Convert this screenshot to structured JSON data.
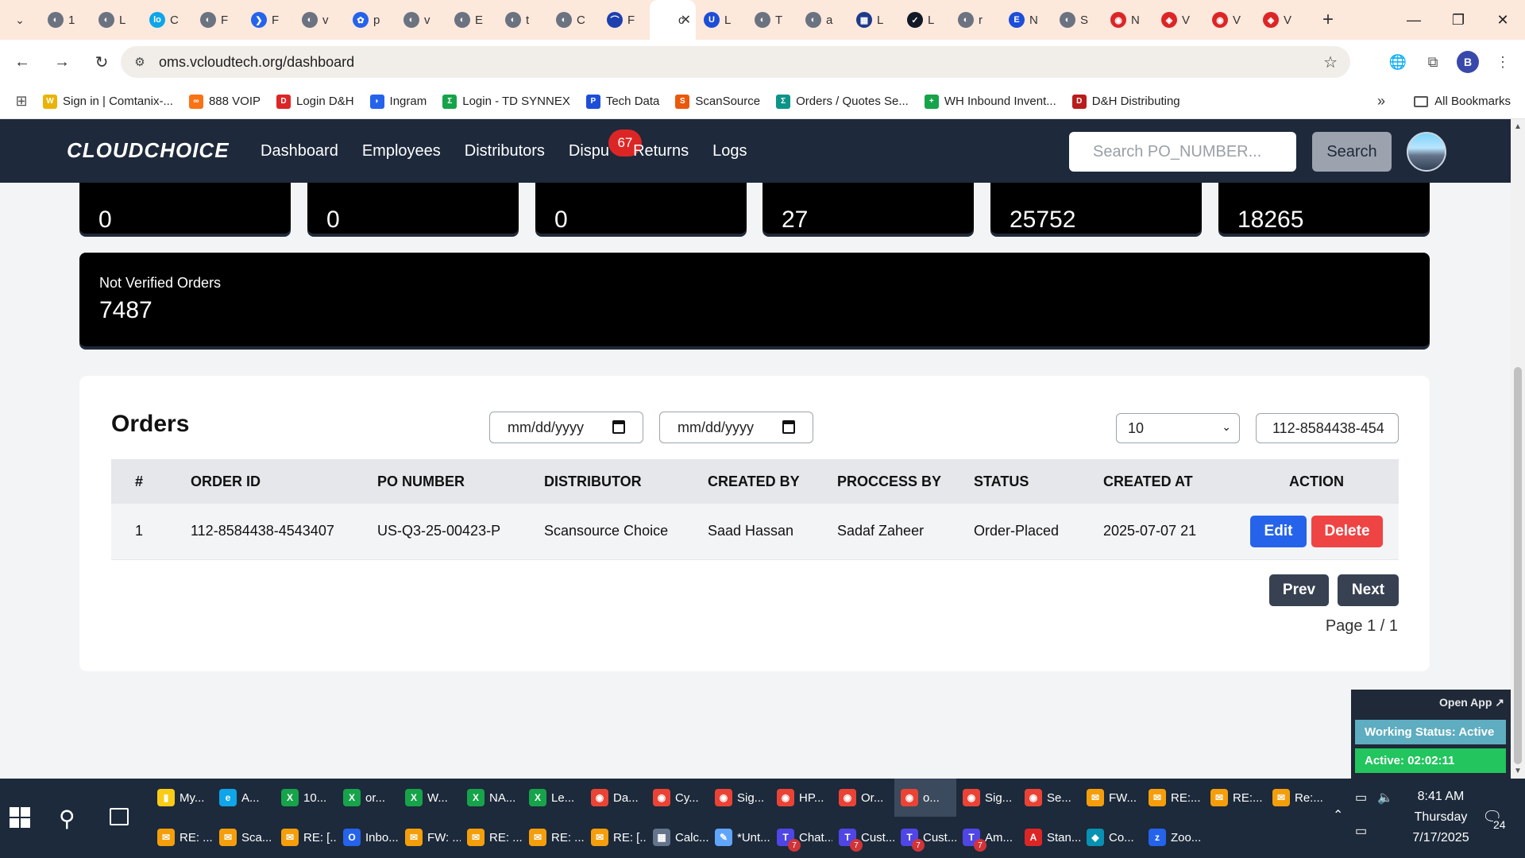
{
  "browser": {
    "tabs": [
      {
        "title": "1",
        "color": "#6b7280",
        "glyph": "◐"
      },
      {
        "title": "L",
        "color": "#6b7280",
        "glyph": "◐"
      },
      {
        "title": "C",
        "color": "#0ea5e9",
        "glyph": "lo"
      },
      {
        "title": "F",
        "color": "#6b7280",
        "glyph": "◐"
      },
      {
        "title": "F",
        "color": "#2563eb",
        "glyph": "❯"
      },
      {
        "title": "v",
        "color": "#6b7280",
        "glyph": "◐"
      },
      {
        "title": "p",
        "color": "#2563eb",
        "glyph": "✿"
      },
      {
        "title": "v",
        "color": "#6b7280",
        "glyph": "◐"
      },
      {
        "title": "E",
        "color": "#6b7280",
        "glyph": "◐"
      },
      {
        "title": "t",
        "color": "#6b7280",
        "glyph": "◐"
      },
      {
        "title": "C",
        "color": "#6b7280",
        "glyph": "◐"
      },
      {
        "title": "F",
        "color": "#1e40af",
        "glyph": "⌒"
      },
      {
        "title": "c",
        "color": "#ffffff",
        "glyph": "",
        "active": true
      },
      {
        "title": "L",
        "color": "#1d4ed8",
        "glyph": "U"
      },
      {
        "title": "T",
        "color": "#6b7280",
        "glyph": "◐"
      },
      {
        "title": "a",
        "color": "#6b7280",
        "glyph": "◐"
      },
      {
        "title": "L",
        "color": "#1e3a8a",
        "glyph": "▦"
      },
      {
        "title": "L",
        "color": "#111827",
        "glyph": "✓"
      },
      {
        "title": "r",
        "color": "#6b7280",
        "glyph": "◐"
      },
      {
        "title": "N",
        "color": "#1d4ed8",
        "glyph": "E"
      },
      {
        "title": "S",
        "color": "#6b7280",
        "glyph": "◐"
      },
      {
        "title": "N",
        "color": "#dc2626",
        "glyph": "◉"
      },
      {
        "title": "V",
        "color": "#dc2626",
        "glyph": "◈"
      },
      {
        "title": "V",
        "color": "#dc2626",
        "glyph": "◉"
      },
      {
        "title": "V",
        "color": "#dc2626",
        "glyph": "◈"
      }
    ],
    "url": "oms.vcloudtech.org/dashboard",
    "profile_initial": "B",
    "bookmarks": [
      {
        "label": "Sign in | Comtanix-...",
        "color": "#eab308",
        "glyph": "W"
      },
      {
        "label": "888 VOIP",
        "color": "#f97316",
        "glyph": "∞"
      },
      {
        "label": "Login D&H",
        "color": "#dc2626",
        "glyph": "D"
      },
      {
        "label": "Ingram",
        "color": "#2563eb",
        "glyph": "◗"
      },
      {
        "label": "Login - TD SYNNEX",
        "color": "#16a34a",
        "glyph": "Σ"
      },
      {
        "label": "Tech Data",
        "color": "#1d4ed8",
        "glyph": "P"
      },
      {
        "label": "ScanSource",
        "color": "#ea580c",
        "glyph": "S"
      },
      {
        "label": "Orders / Quotes Se...",
        "color": "#0d9488",
        "glyph": "Σ"
      },
      {
        "label": "WH Inbound Invent...",
        "color": "#16a34a",
        "glyph": "+"
      },
      {
        "label": "D&H Distributing",
        "color": "#b91c1c",
        "glyph": "D"
      }
    ],
    "all_bookmarks": "All Bookmarks"
  },
  "app": {
    "logo": "CLOUDCHOICE",
    "nav": [
      "Dashboard",
      "Employees",
      "Distributors",
      "Dispu",
      "Returns",
      "Logs"
    ],
    "dispute_badge": "67",
    "search_placeholder": "Search PO_NUMBER...",
    "search_button": "Search",
    "stats": [
      "0",
      "0",
      "0",
      "27",
      "25752",
      "18265"
    ],
    "not_verified": {
      "label": "Not Verified Orders",
      "value": "7487"
    },
    "orders": {
      "title": "Orders",
      "date_from": "mm/dd/yyyy",
      "date_to": "mm/dd/yyyy",
      "per_page": "10",
      "filter_value": "112-8584438-454",
      "columns": [
        "#",
        "ORDER ID",
        "PO NUMBER",
        "DISTRIBUTOR",
        "CREATED BY",
        "PROCCESS BY",
        "STATUS",
        "CREATED AT",
        "ACTION"
      ],
      "rows": [
        [
          "1",
          "112-8584438-4543407",
          "US-Q3-25-00423-P",
          "Scansource Choice",
          "Saad Hassan",
          "Sadaf Zaheer",
          "Order-Placed",
          "2025-07-07 21"
        ]
      ],
      "edit_label": "Edit",
      "delete_label": "Delete",
      "prev_label": "Prev",
      "next_label": "Next",
      "page_info": "Page 1 / 1"
    },
    "widget": {
      "open_app": "Open App ↗",
      "working_status": "Working Status: Active",
      "active_time": "Active: 02:02:11"
    }
  },
  "taskbar": {
    "row1": [
      {
        "label": "My...",
        "color": "#facc15",
        "glyph": "▮"
      },
      {
        "label": "A...",
        "color": "#0ea5e9",
        "glyph": "e"
      },
      {
        "label": "10...",
        "color": "#16a34a",
        "glyph": "X"
      },
      {
        "label": "or...",
        "color": "#16a34a",
        "glyph": "X"
      },
      {
        "label": "W...",
        "color": "#16a34a",
        "glyph": "X"
      },
      {
        "label": "NA...",
        "color": "#16a34a",
        "glyph": "X"
      },
      {
        "label": "Le...",
        "color": "#16a34a",
        "glyph": "X"
      },
      {
        "label": "Da...",
        "color": "#ea4335",
        "glyph": "◉"
      },
      {
        "label": "Cy...",
        "color": "#ea4335",
        "glyph": "◉"
      },
      {
        "label": "Sig...",
        "color": "#ea4335",
        "glyph": "◉"
      },
      {
        "label": "HP...",
        "color": "#ea4335",
        "glyph": "◉"
      },
      {
        "label": "Or...",
        "color": "#ea4335",
        "glyph": "◉"
      },
      {
        "label": "o...",
        "color": "#ea4335",
        "glyph": "◉",
        "sel": true
      },
      {
        "label": "Sig...",
        "color": "#ea4335",
        "glyph": "◉"
      },
      {
        "label": "Se...",
        "color": "#ea4335",
        "glyph": "◉"
      },
      {
        "label": "FW...",
        "color": "#f59e0b",
        "glyph": "✉"
      },
      {
        "label": "RE:...",
        "color": "#f59e0b",
        "glyph": "✉"
      },
      {
        "label": "RE:...",
        "color": "#f59e0b",
        "glyph": "✉"
      },
      {
        "label": "Re:...",
        "color": "#f59e0b",
        "glyph": "✉"
      }
    ],
    "row2": [
      {
        "label": "RE: ...",
        "color": "#f59e0b",
        "glyph": "✉"
      },
      {
        "label": "Sca...",
        "color": "#f59e0b",
        "glyph": "✉"
      },
      {
        "label": "RE: [...",
        "color": "#f59e0b",
        "glyph": "✉"
      },
      {
        "label": "Inbo...",
        "color": "#2563eb",
        "glyph": "O"
      },
      {
        "label": "FW: ...",
        "color": "#f59e0b",
        "glyph": "✉"
      },
      {
        "label": "RE: ...",
        "color": "#f59e0b",
        "glyph": "✉"
      },
      {
        "label": "RE: ...",
        "color": "#f59e0b",
        "glyph": "✉"
      },
      {
        "label": "RE: [...",
        "color": "#f59e0b",
        "glyph": "✉"
      },
      {
        "label": "Calc...",
        "color": "#64748b",
        "glyph": "▦"
      },
      {
        "label": "*Unt...",
        "color": "#60a5fa",
        "glyph": "✎"
      },
      {
        "label": "Chat...",
        "color": "#4f46e5",
        "glyph": "T",
        "badge": "7"
      },
      {
        "label": "Cust...",
        "color": "#4f46e5",
        "glyph": "T",
        "badge": "7"
      },
      {
        "label": "Cust...",
        "color": "#4f46e5",
        "glyph": "T",
        "badge": "7"
      },
      {
        "label": "Am...",
        "color": "#4f46e5",
        "glyph": "T",
        "badge": "7"
      },
      {
        "label": "Stan...",
        "color": "#dc2626",
        "glyph": "A"
      },
      {
        "label": "Co...",
        "color": "#0891b2",
        "glyph": "◆"
      },
      {
        "label": "Zoo...",
        "color": "#2563eb",
        "glyph": "z"
      }
    ],
    "time": "8:41 AM",
    "day": "Thursday",
    "date": "7/17/2025",
    "notif_count": "24"
  }
}
